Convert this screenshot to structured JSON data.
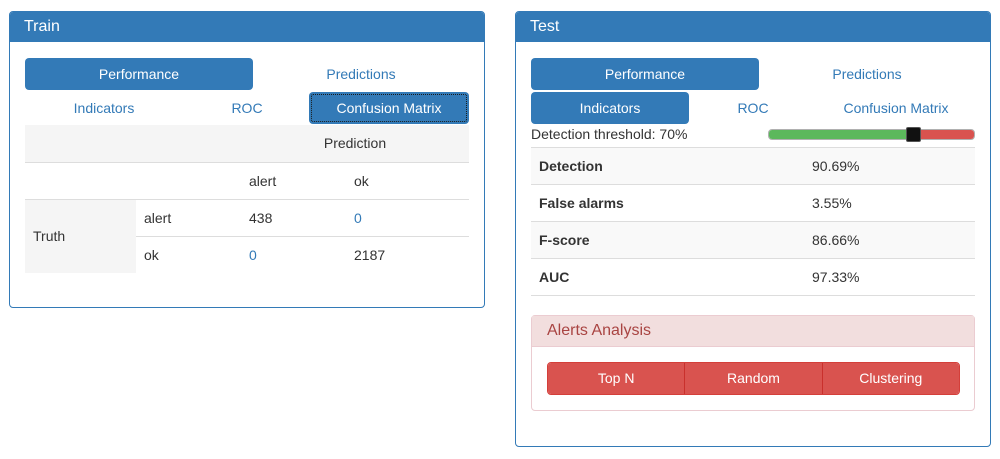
{
  "train": {
    "title": "Train",
    "tabs": {
      "performance": "Performance",
      "predictions": "Predictions"
    },
    "subtabs": {
      "indicators": "Indicators",
      "roc": "ROC",
      "confusion_matrix": "Confusion Matrix"
    },
    "confusion": {
      "prediction_header": "Prediction",
      "col_alert": "alert",
      "col_ok": "ok",
      "truth_label": "Truth",
      "row_alert": "alert",
      "row_ok": "ok",
      "alert_alert": "438",
      "alert_ok": "0",
      "ok_alert": "0",
      "ok_ok": "2187"
    }
  },
  "test": {
    "title": "Test",
    "tabs": {
      "performance": "Performance",
      "predictions": "Predictions"
    },
    "subtabs": {
      "indicators": "Indicators",
      "roc": "ROC",
      "confusion_matrix": "Confusion Matrix"
    },
    "threshold": {
      "label": "Detection threshold: 70%",
      "value": 0.7
    },
    "metrics": [
      {
        "label": "Detection",
        "value": "90.69%"
      },
      {
        "label": "False alarms",
        "value": "3.55%"
      },
      {
        "label": "F-score",
        "value": "86.66%"
      },
      {
        "label": "AUC",
        "value": "97.33%"
      }
    ],
    "alerts": {
      "title": "Alerts Analysis",
      "buttons": {
        "top_n": "Top N",
        "random": "Random",
        "clustering": "Clustering"
      }
    }
  },
  "colors": {
    "primary": "#337ab7",
    "success": "#5cb85c",
    "danger": "#d9534f",
    "danger_bg": "#f2dede",
    "danger_text": "#a94442"
  }
}
